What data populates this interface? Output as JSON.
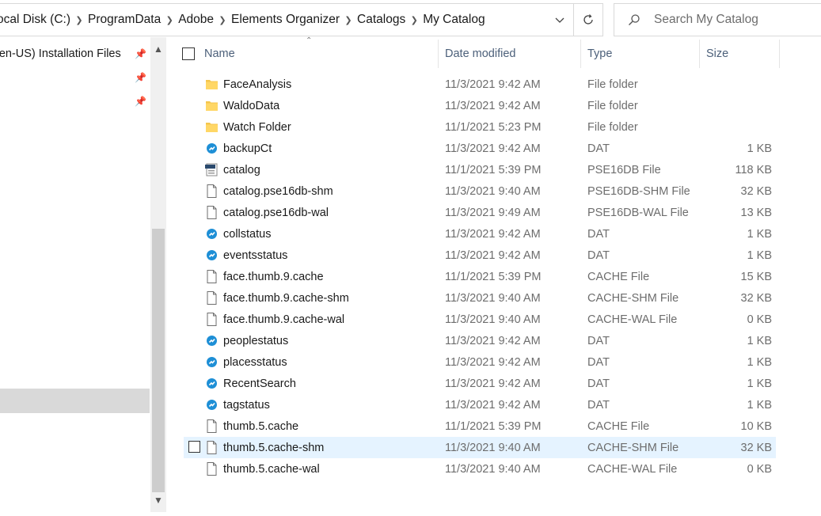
{
  "address": {
    "crumbs": [
      "ocal Disk (C:)",
      "ProgramData",
      "Adobe",
      "Elements Organizer",
      "Catalogs",
      "My Catalog"
    ]
  },
  "search": {
    "placeholder": "Search My Catalog"
  },
  "nav": {
    "items": [
      {
        "label": "(en-US) Installation Files",
        "pinned": true
      },
      {
        "label": "",
        "pinned": true
      },
      {
        "label": "",
        "pinned": true
      }
    ]
  },
  "columns": {
    "name": "Name",
    "date": "Date modified",
    "type": "Type",
    "size": "Size"
  },
  "files": [
    {
      "name": "FaceAnalysis",
      "date": "11/3/2021 9:42 AM",
      "type": "File folder",
      "size": "",
      "icon": "folder-icon"
    },
    {
      "name": "WaldoData",
      "date": "11/3/2021 9:42 AM",
      "type": "File folder",
      "size": "",
      "icon": "folder-icon"
    },
    {
      "name": "Watch Folder",
      "date": "11/1/2021 5:23 PM",
      "type": "File folder",
      "size": "",
      "icon": "folder-icon"
    },
    {
      "name": "backupCt",
      "date": "11/3/2021 9:42 AM",
      "type": "DAT",
      "size": "1 KB",
      "icon": "dat-file-icon"
    },
    {
      "name": "catalog",
      "date": "11/1/2021 5:39 PM",
      "type": "PSE16DB File",
      "size": "118 KB",
      "icon": "database-file-icon"
    },
    {
      "name": "catalog.pse16db-shm",
      "date": "11/3/2021 9:40 AM",
      "type": "PSE16DB-SHM File",
      "size": "32 KB",
      "icon": "blank-file-icon"
    },
    {
      "name": "catalog.pse16db-wal",
      "date": "11/3/2021 9:49 AM",
      "type": "PSE16DB-WAL File",
      "size": "13 KB",
      "icon": "blank-file-icon"
    },
    {
      "name": "collstatus",
      "date": "11/3/2021 9:42 AM",
      "type": "DAT",
      "size": "1 KB",
      "icon": "dat-file-icon"
    },
    {
      "name": "eventsstatus",
      "date": "11/3/2021 9:42 AM",
      "type": "DAT",
      "size": "1 KB",
      "icon": "dat-file-icon"
    },
    {
      "name": "face.thumb.9.cache",
      "date": "11/1/2021 5:39 PM",
      "type": "CACHE File",
      "size": "15 KB",
      "icon": "blank-file-icon"
    },
    {
      "name": "face.thumb.9.cache-shm",
      "date": "11/3/2021 9:40 AM",
      "type": "CACHE-SHM File",
      "size": "32 KB",
      "icon": "blank-file-icon"
    },
    {
      "name": "face.thumb.9.cache-wal",
      "date": "11/3/2021 9:40 AM",
      "type": "CACHE-WAL File",
      "size": "0 KB",
      "icon": "blank-file-icon"
    },
    {
      "name": "peoplestatus",
      "date": "11/3/2021 9:42 AM",
      "type": "DAT",
      "size": "1 KB",
      "icon": "dat-file-icon"
    },
    {
      "name": "placesstatus",
      "date": "11/3/2021 9:42 AM",
      "type": "DAT",
      "size": "1 KB",
      "icon": "dat-file-icon"
    },
    {
      "name": "RecentSearch",
      "date": "11/3/2021 9:42 AM",
      "type": "DAT",
      "size": "1 KB",
      "icon": "dat-file-icon"
    },
    {
      "name": "tagstatus",
      "date": "11/3/2021 9:42 AM",
      "type": "DAT",
      "size": "1 KB",
      "icon": "dat-file-icon"
    },
    {
      "name": "thumb.5.cache",
      "date": "11/1/2021 5:39 PM",
      "type": "CACHE File",
      "size": "10 KB",
      "icon": "blank-file-icon"
    },
    {
      "name": "thumb.5.cache-shm",
      "date": "11/3/2021 9:40 AM",
      "type": "CACHE-SHM File",
      "size": "32 KB",
      "icon": "blank-file-icon",
      "hover": true
    },
    {
      "name": "thumb.5.cache-wal",
      "date": "11/3/2021 9:40 AM",
      "type": "CACHE-WAL File",
      "size": "0 KB",
      "icon": "blank-file-icon"
    }
  ],
  "colors": {
    "hover_row": "#e5f3ff",
    "header_text": "#4c607a",
    "folder": "#f4c64d",
    "dat_icon": "#1e8fd6"
  }
}
